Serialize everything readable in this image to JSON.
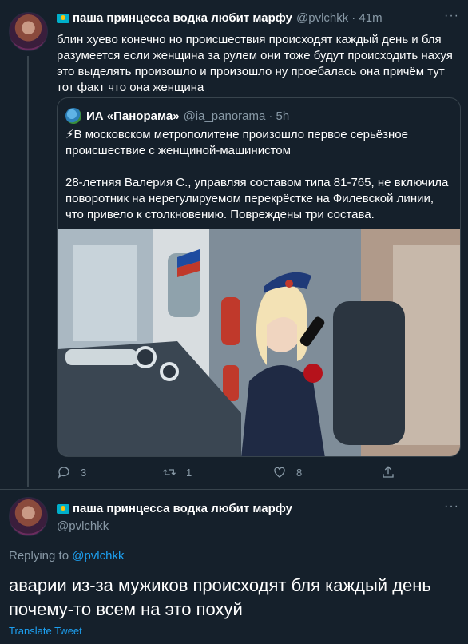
{
  "tweet1": {
    "display_name": "паша принцесса водка любит марфу",
    "handle": "@pvlchkk",
    "time": "· 41m",
    "text": "блин хуево конечно но происшествия происходят каждый день и бля разумеется если женщина за рулем они тоже будут происходить нахуя это выделять произошло и произошло ну проебалась она причём тут тот факт что она женщина",
    "quote": {
      "display_name": "ИА «Панорама»",
      "handle": "@ia_panorama",
      "time": "· 5h",
      "text_line1": "⚡В московском метрополитене произошло первое серьёзное происшествие с женщиной-машинистом",
      "text_line2": "28-летняя Валерия С., управляя составом типа 81-765, не включила поворотник на нерегулируемом перекрёстке на Филевской линии, что привело к столкновению. Повреждены три состава.",
      "image_icon": "metro-driver-photo"
    },
    "actions": {
      "reply_count": "3",
      "retweet_count": "1",
      "like_count": "8"
    }
  },
  "tweet2": {
    "display_name": "паша принцесса водка любит марфу",
    "handle": "@pvlchkk",
    "replying_prefix": "Replying to ",
    "replying_handle": "@pvlchkk",
    "text": "аварии из-за мужиков происходят бля каждый день почему-то всем на это похуй",
    "translate": "Translate Tweet"
  },
  "colors": {
    "background": "#15202b",
    "text": "#ffffff",
    "muted": "#8899a6",
    "accent": "#1da1f2",
    "border": "#38444d"
  }
}
